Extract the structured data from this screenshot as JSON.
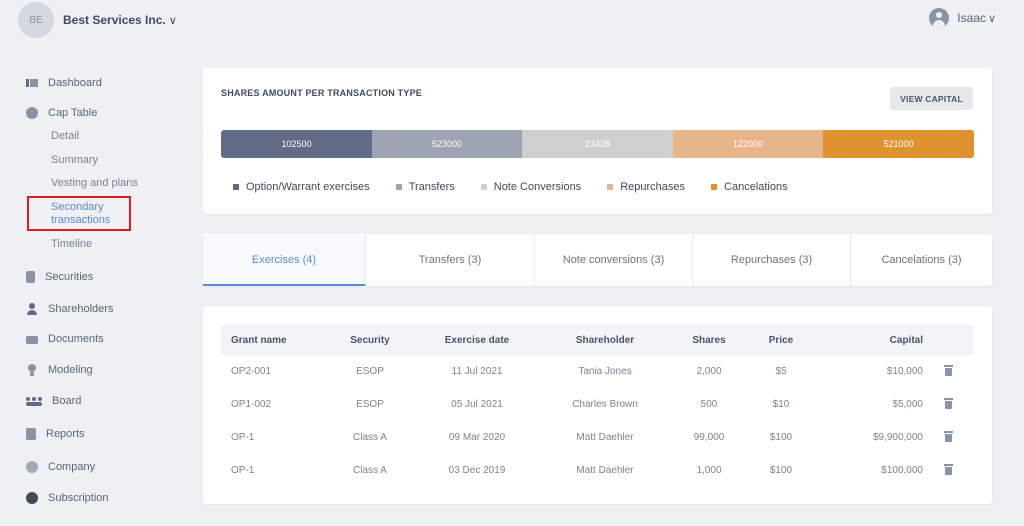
{
  "header": {
    "company_initials": "BE",
    "company_name": "Best Services Inc.",
    "company_chevron": "∨",
    "user_name": "Isaac",
    "user_chevron": "∨",
    "user_icon": "user-circle-icon"
  },
  "sidebar": {
    "items": [
      {
        "label": "Dashboard",
        "icon": "dashboard-icon"
      },
      {
        "label": "Cap Table",
        "icon": "pie-chart-icon"
      },
      {
        "label": "Securities",
        "icon": "document-icon"
      },
      {
        "label": "Shareholders",
        "icon": "person-icon"
      },
      {
        "label": "Documents",
        "icon": "folder-icon"
      },
      {
        "label": "Modeling",
        "icon": "lightbulb-icon"
      },
      {
        "label": "Board",
        "icon": "group-icon"
      },
      {
        "label": "Reports",
        "icon": "report-icon"
      },
      {
        "label": "Company",
        "icon": "gear-icon"
      },
      {
        "label": "Subscription",
        "icon": "dollar-icon"
      }
    ],
    "cap_table_sub": [
      {
        "label": "Detail"
      },
      {
        "label": "Summary"
      },
      {
        "label": "Vesting and plans"
      },
      {
        "label": "Secondary transactions",
        "line1": "Secondary",
        "line2": "transactions",
        "active": true
      },
      {
        "label": "Timeline"
      }
    ]
  },
  "shares_card": {
    "title": "SHARES AMOUNT PER TRANSACTION TYPE",
    "view_capital": "VIEW CAPITAL",
    "segments": [
      {
        "value": "102500",
        "color": "#626b86"
      },
      {
        "value": "523000",
        "color": "#9ea4b3"
      },
      {
        "value": "23428",
        "color": "#cfcfcf"
      },
      {
        "value": "122000",
        "color": "#e8b48a"
      },
      {
        "value": "521000",
        "color": "#e0922e"
      }
    ],
    "legend": [
      {
        "label": "Option/Warrant exercises",
        "color": "#626b86"
      },
      {
        "label": "Transfers",
        "color": "#9ea4b3"
      },
      {
        "label": "Note Conversions",
        "color": "#cfcfcf"
      },
      {
        "label": "Repurchases",
        "color": "#e8b48a"
      },
      {
        "label": "Cancelations",
        "color": "#e0922e"
      }
    ]
  },
  "tabs": [
    {
      "label": "Exercises (4)",
      "active": true
    },
    {
      "label": "Transfers (3)"
    },
    {
      "label": "Note conversions (3)"
    },
    {
      "label": "Repurchases (3)"
    },
    {
      "label": "Cancelations (3)"
    }
  ],
  "table": {
    "headers": [
      "Grant name",
      "Security",
      "Exercise date",
      "Shareholder",
      "Shares",
      "Price",
      "Capital"
    ],
    "rows": [
      [
        "OP2-001",
        "ESOP",
        "11 Jul 2021",
        "Tania Jones",
        "2,000",
        "$5",
        "$10,000"
      ],
      [
        "OP1-002",
        "ESOP",
        "05 Jul 2021",
        "Charles Brown",
        "500",
        "$10",
        "$5,000"
      ],
      [
        "OP-1",
        "Class A",
        "09 Mar 2020",
        "Matt Daehler",
        "99,000",
        "$100",
        "$9,900,000"
      ],
      [
        "OP-1",
        "Class A",
        "03 Dec 2019",
        "Matt Daehler",
        "1,000",
        "$100",
        "$100,000"
      ]
    ],
    "delete_icon": "trash-icon"
  }
}
